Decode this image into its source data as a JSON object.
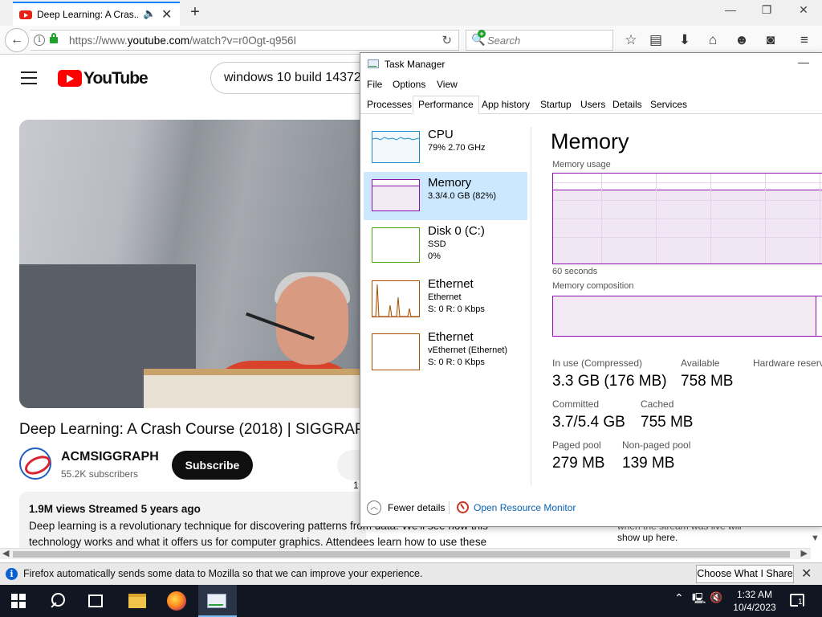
{
  "browser": {
    "tab_title": "Deep Learning: A Cras...",
    "url_prefix": "https://www.",
    "url_domain": "youtube.com",
    "url_path": "/watch?v=r0Ogt-q956I",
    "search_placeholder": "Search",
    "window_controls": {
      "minimize": "—",
      "restore": "❐",
      "close": "✕"
    }
  },
  "youtube": {
    "logo_text": "YouTube",
    "search_value": "windows 10 build 14372",
    "video_title": "Deep Learning: A Crash Course (2018) | SIGGRAPH",
    "channel_name": "ACMSIGGRAPH",
    "subscribers": "55.2K subscribers",
    "subscribe_label": "Subscribe",
    "like_count": "1",
    "views_meta": "1.9M views  Streamed 5 years ago",
    "description_lines": [
      "Deep learning is a revolutionary technique for discovering patterns from data. We'll see how this",
      "technology works and what it offers us for computer graphics. Attendees learn how to use these"
    ],
    "live_chat_line1": "when the stream was live will",
    "live_chat_line2": "show up here."
  },
  "notification": {
    "text": "Firefox automatically sends some data to Mozilla so that we can improve your experience.",
    "button": "Choose What I Share"
  },
  "taskbar": {
    "time": "1:32 AM",
    "date": "10/4/2023",
    "notification_count": "1"
  },
  "task_manager": {
    "title": "Task Manager",
    "menu": [
      "File",
      "Options",
      "View"
    ],
    "tabs": [
      "Processes",
      "Performance",
      "App history",
      "Startup",
      "Users",
      "Details",
      "Services"
    ],
    "active_tab": "Performance",
    "sidebar": [
      {
        "name": "CPU",
        "line1": "79%  2.70 GHz",
        "line2": "",
        "color": "#1b8ec9"
      },
      {
        "name": "Memory",
        "line1": "3.3/4.0 GB (82%)",
        "line2": "",
        "color": "#8b12ae"
      },
      {
        "name": "Disk 0 (C:)",
        "line1": "SSD",
        "line2": "0%",
        "color": "#4da60c"
      },
      {
        "name": "Ethernet",
        "line1": "Ethernet",
        "line2": "S: 0 R: 0 Kbps",
        "color": "#a74f01"
      },
      {
        "name": "Ethernet",
        "line1": "vEthernet (Ethernet)",
        "line2": "S: 0 R: 0 Kbps",
        "color": "#a74f01"
      }
    ],
    "memory": {
      "title": "Memory",
      "usage_label": "Memory usage",
      "usage_fraction": 0.82,
      "time_span_label": "60 seconds",
      "composition_label": "Memory composition",
      "stats": {
        "in_use_label": "In use (Compressed)",
        "in_use_value": "3.3 GB (176 MB)",
        "available_label": "Available",
        "available_value": "758 MB",
        "hw_reserved_label": "Hardware reserved",
        "committed_label": "Committed",
        "committed_value": "3.7/5.4 GB",
        "cached_label": "Cached",
        "cached_value": "755 MB",
        "paged_label": "Paged pool",
        "paged_value": "279 MB",
        "nonpaged_label": "Non-paged pool",
        "nonpaged_value": "139 MB"
      }
    },
    "footer": {
      "fewer_details": "Fewer details",
      "resource_monitor": "Open Resource Monitor"
    }
  }
}
